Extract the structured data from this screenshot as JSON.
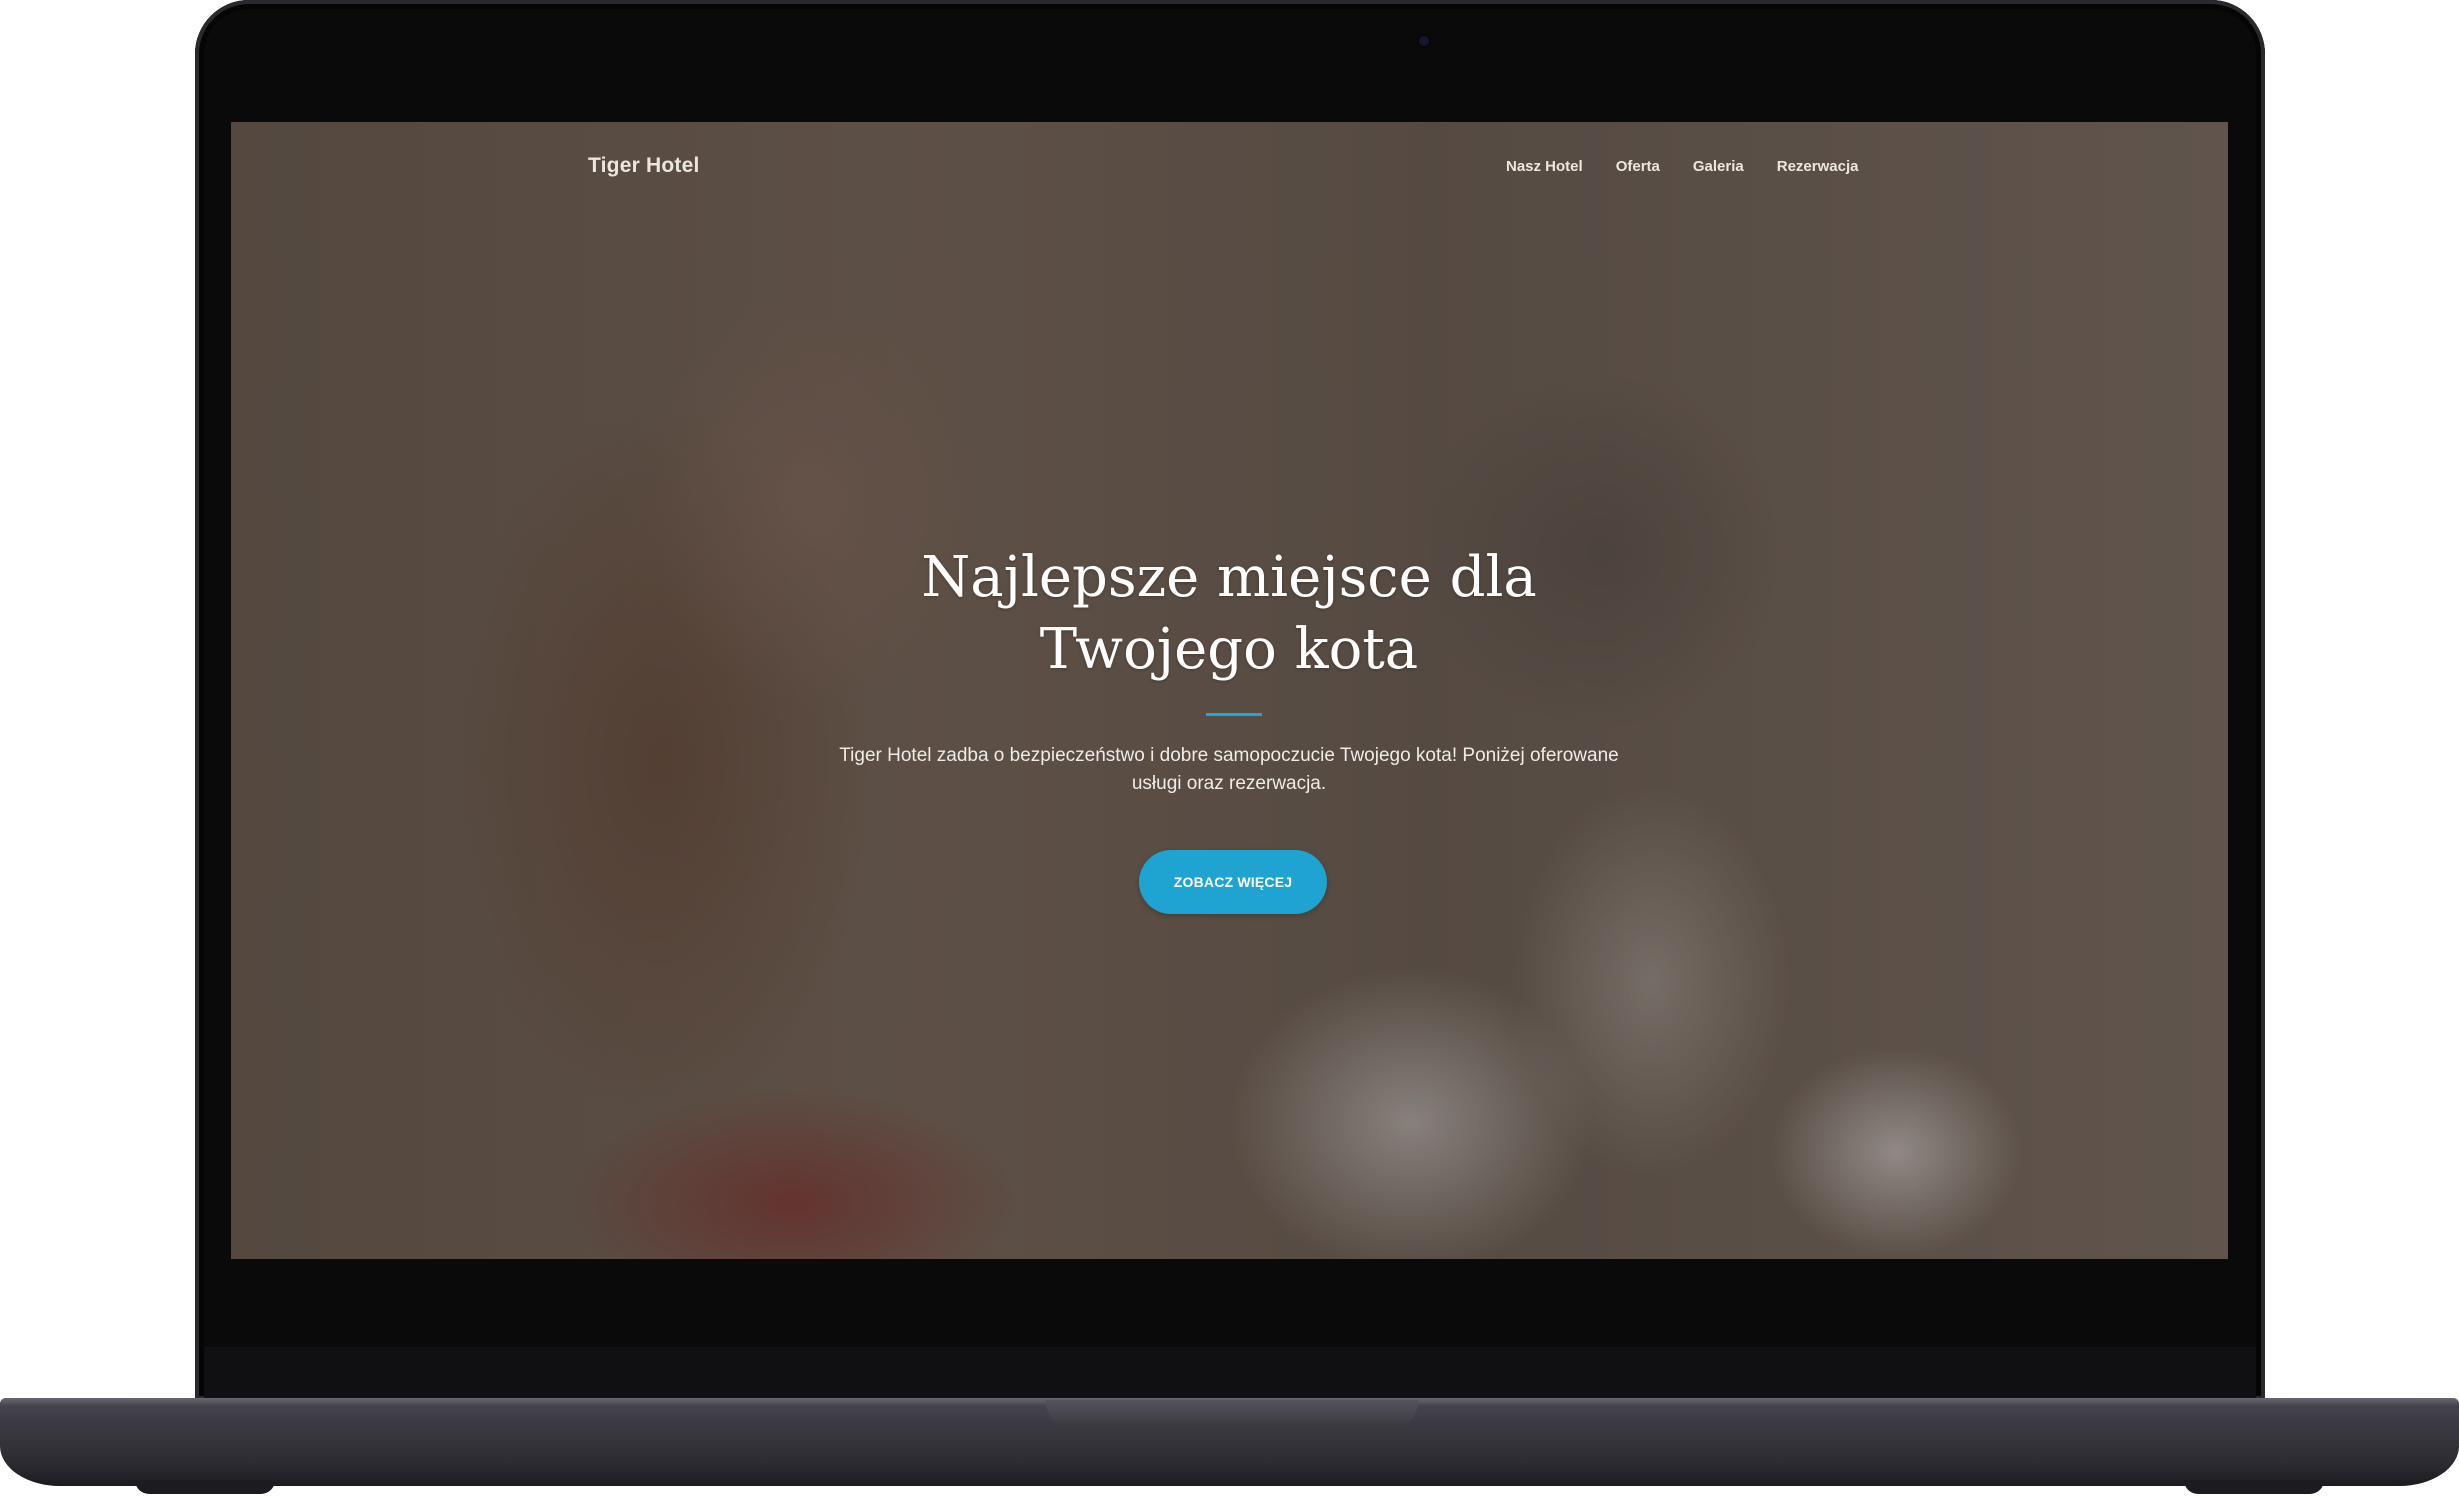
{
  "site": {
    "logo": "Tiger Hotel",
    "nav": [
      "Nasz Hotel",
      "Oferta",
      "Galeria",
      "Rezerwacja"
    ]
  },
  "hero": {
    "title_lines": [
      "Najlepsze miejsce dla",
      "Twojego kota"
    ],
    "text_lines": [
      "Tiger Hotel zadba o bezpieczeństwo i dobre samopoczucie Twojego kota! Poniżej oferowane",
      "usługi oraz rezerwacja."
    ],
    "cta_label": "ZOBACZ WIĘCEJ",
    "background_photo": "woman holding a black-and-white cat",
    "overlay_color": "#3c322c"
  },
  "colors": {
    "accent": "#1fa3d1",
    "laptop_body": "#0a0a0b",
    "laptop_base": "#3b3a42"
  }
}
